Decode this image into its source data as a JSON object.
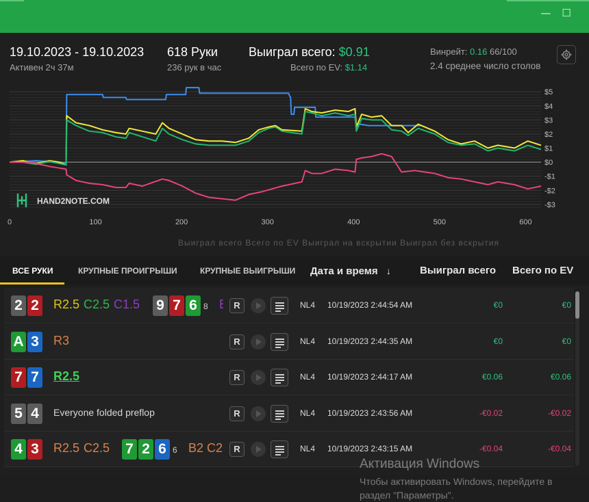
{
  "window": {
    "minimize_icon": "minimize-icon",
    "maximize_icon": "maximize-icon",
    "minimize_glyph": "—",
    "maximize_glyph": "☐"
  },
  "header": {
    "date_range": "19.10.2023 - 19.10.2023",
    "active_time": "Активен 2ч 37м",
    "hands": "618 Руки",
    "hands_per_hour": "236 рук в час",
    "won_total_label": "Выиграл всего:",
    "won_total_value": "$0.91",
    "ev_total_label": "Всего по EV:",
    "ev_total_value": "$1.14",
    "winrate_label": "Винрейт:",
    "winrate_value": "0.16",
    "winrate_hands": "66/100",
    "avg_tables": "2.4 среднее число столов"
  },
  "chart_data": {
    "type": "line",
    "x_ticks": [
      "0",
      "100",
      "200",
      "300",
      "400",
      "500",
      "600"
    ],
    "y_ticks": [
      "$5",
      "$4",
      "$3",
      "$2",
      "$1",
      "$0",
      "-$1",
      "-$2",
      "-$3"
    ],
    "xlim": [
      0,
      618
    ],
    "ylim": [
      -3.3,
      5.4
    ],
    "watermark": "HAND2NOTE.COM",
    "faded_legend": "Выиграл всего  Всего по EV  Выиграл на вскрытии  Выиграл без вскрытия",
    "series": [
      {
        "color": "#3d8ef0",
        "points": [
          [
            0,
            0
          ],
          [
            40,
            0.1
          ],
          [
            75,
            0
          ],
          [
            85,
            -0.05
          ],
          [
            86,
            4.8
          ],
          [
            140,
            4.8
          ],
          [
            141,
            4.6
          ],
          [
            175,
            4.6
          ],
          [
            176,
            4.45
          ],
          [
            235,
            4.45
          ],
          [
            236,
            4.8
          ],
          [
            265,
            4.8
          ],
          [
            266,
            5.3
          ],
          [
            285,
            5.3
          ],
          [
            286,
            4.9
          ],
          [
            420,
            4.9
          ],
          [
            421,
            4.75
          ],
          [
            423,
            4.6
          ],
          [
            424,
            3.4
          ],
          [
            428,
            3.4
          ],
          [
            429,
            3.9
          ],
          [
            460,
            3.9
          ],
          [
            461,
            3.2
          ],
          [
            520,
            3.2
          ],
          [
            521,
            2.75
          ],
          [
            540,
            2.6
          ],
          [
            620,
            2.6
          ]
        ]
      },
      {
        "color": "#f2ea3a",
        "points": [
          [
            0,
            0
          ],
          [
            20,
            0.1
          ],
          [
            40,
            -0.1
          ],
          [
            60,
            0.1
          ],
          [
            75,
            0
          ],
          [
            85,
            -0.2
          ],
          [
            86,
            3.3
          ],
          [
            100,
            2.8
          ],
          [
            120,
            2.6
          ],
          [
            140,
            2.3
          ],
          [
            160,
            2.1
          ],
          [
            175,
            2.0
          ],
          [
            180,
            2.4
          ],
          [
            200,
            2.2
          ],
          [
            220,
            2.0
          ],
          [
            230,
            2.8
          ],
          [
            240,
            2.4
          ],
          [
            260,
            2.0
          ],
          [
            280,
            1.6
          ],
          [
            300,
            1.5
          ],
          [
            320,
            1.5
          ],
          [
            340,
            1.4
          ],
          [
            360,
            1.7
          ],
          [
            375,
            2.3
          ],
          [
            390,
            2.5
          ],
          [
            400,
            2.6
          ],
          [
            410,
            2.3
          ],
          [
            440,
            2.2
          ],
          [
            445,
            3.8
          ],
          [
            455,
            3.6
          ],
          [
            470,
            3.5
          ],
          [
            490,
            3.7
          ],
          [
            510,
            3.6
          ],
          [
            520,
            3.8
          ],
          [
            522,
            2.5
          ],
          [
            530,
            3.4
          ],
          [
            545,
            3.2
          ],
          [
            560,
            3.3
          ],
          [
            575,
            2.6
          ],
          [
            590,
            2.6
          ],
          [
            600,
            2.1
          ],
          [
            615,
            2.7
          ],
          [
            640,
            2.2
          ],
          [
            660,
            1.6
          ],
          [
            680,
            1.3
          ],
          [
            700,
            1.5
          ],
          [
            720,
            1.0
          ],
          [
            735,
            1.2
          ],
          [
            760,
            1.0
          ],
          [
            780,
            1.5
          ],
          [
            800,
            1.2
          ]
        ]
      },
      {
        "color": "#22b86a",
        "points": [
          [
            0,
            0
          ],
          [
            20,
            0
          ],
          [
            40,
            -0.15
          ],
          [
            60,
            0.05
          ],
          [
            75,
            -0.1
          ],
          [
            85,
            -0.2
          ],
          [
            86,
            3.0
          ],
          [
            100,
            2.6
          ],
          [
            120,
            2.2
          ],
          [
            140,
            2.1
          ],
          [
            160,
            1.8
          ],
          [
            175,
            1.7
          ],
          [
            180,
            2.1
          ],
          [
            200,
            1.8
          ],
          [
            220,
            1.5
          ],
          [
            230,
            2.4
          ],
          [
            240,
            2.0
          ],
          [
            260,
            1.6
          ],
          [
            280,
            1.3
          ],
          [
            300,
            1.2
          ],
          [
            320,
            1.2
          ],
          [
            340,
            1.2
          ],
          [
            360,
            1.5
          ],
          [
            375,
            2.1
          ],
          [
            390,
            2.4
          ],
          [
            400,
            2.5
          ],
          [
            410,
            2.2
          ],
          [
            440,
            2.0
          ],
          [
            445,
            3.6
          ],
          [
            455,
            3.5
          ],
          [
            470,
            3.3
          ],
          [
            490,
            3.5
          ],
          [
            510,
            3.3
          ],
          [
            520,
            3.4
          ],
          [
            522,
            2.2
          ],
          [
            530,
            3.1
          ],
          [
            545,
            3.0
          ],
          [
            560,
            3.0
          ],
          [
            575,
            2.3
          ],
          [
            590,
            2.2
          ],
          [
            600,
            1.9
          ],
          [
            615,
            2.4
          ],
          [
            640,
            2.0
          ],
          [
            660,
            1.4
          ],
          [
            680,
            1.2
          ],
          [
            700,
            1.3
          ],
          [
            720,
            0.8
          ],
          [
            735,
            1.0
          ],
          [
            760,
            0.8
          ],
          [
            780,
            1.2
          ],
          [
            800,
            0.9
          ]
        ]
      },
      {
        "color": "#e8437a",
        "points": [
          [
            0,
            0
          ],
          [
            30,
            0
          ],
          [
            60,
            -0.3
          ],
          [
            85,
            -0.5
          ],
          [
            86,
            -0.9
          ],
          [
            100,
            -1.3
          ],
          [
            120,
            -1.5
          ],
          [
            140,
            -1.6
          ],
          [
            160,
            -1.8
          ],
          [
            175,
            -1.8
          ],
          [
            180,
            -1.5
          ],
          [
            200,
            -1.7
          ],
          [
            230,
            -1.2
          ],
          [
            240,
            -1.3
          ],
          [
            260,
            -1.7
          ],
          [
            280,
            -2.2
          ],
          [
            300,
            -2.5
          ],
          [
            320,
            -2.6
          ],
          [
            340,
            -2.7
          ],
          [
            360,
            -2.3
          ],
          [
            380,
            -2.1
          ],
          [
            395,
            -1.9
          ],
          [
            410,
            -1.7
          ],
          [
            440,
            -1.4
          ],
          [
            445,
            -0.6
          ],
          [
            455,
            -0.8
          ],
          [
            470,
            -0.8
          ],
          [
            490,
            -0.5
          ],
          [
            510,
            -0.6
          ],
          [
            520,
            -0.7
          ],
          [
            522,
            0.2
          ],
          [
            530,
            0.3
          ],
          [
            545,
            0.4
          ],
          [
            560,
            0.6
          ],
          [
            575,
            0.4
          ],
          [
            590,
            -0.7
          ],
          [
            610,
            -0.6
          ],
          [
            640,
            -0.8
          ],
          [
            660,
            -1.1
          ],
          [
            680,
            -1.2
          ],
          [
            700,
            -1.4
          ],
          [
            720,
            -1.6
          ],
          [
            735,
            -1.4
          ],
          [
            760,
            -1.6
          ],
          [
            780,
            -1.9
          ],
          [
            800,
            -1.7
          ]
        ]
      }
    ]
  },
  "tabs": {
    "all_hands": "ВСЕ РУКИ",
    "big_losses": "КРУПНЫЕ ПРОИГРЫШИ",
    "big_wins": "КРУПНЫЕ ВЫИГРЫШИ"
  },
  "columns": {
    "datetime": "Дата и время",
    "sort_arrow": "↓",
    "won_total": "Выиграл всего",
    "ev_total": "Всего по EV"
  },
  "rows": [
    {
      "hole": [
        {
          "r": "2",
          "c": "gray"
        },
        {
          "r": "2",
          "c": "red"
        }
      ],
      "actions": [
        {
          "t": "R2.5",
          "k": "y"
        },
        {
          "t": "C2.5",
          "k": "g"
        },
        {
          "t": "C1.5",
          "k": "p"
        }
      ],
      "board": [
        {
          "r": "9",
          "c": "gray"
        },
        {
          "r": "7",
          "c": "red"
        },
        {
          "r": "6",
          "c": "green"
        }
      ],
      "turn": "8",
      "river_frag": "E",
      "stake": "NL4",
      "datetime": "10/19/2023 2:44:54 AM",
      "won": "€0",
      "ev": "€0"
    },
    {
      "hole": [
        {
          "r": "A",
          "c": "green"
        },
        {
          "r": "3",
          "c": "blue"
        }
      ],
      "actions": [
        {
          "t": "R3",
          "k": "o"
        }
      ],
      "stake": "NL4",
      "datetime": "10/19/2023 2:44:35 AM",
      "won": "€0",
      "ev": "€0"
    },
    {
      "hole": [
        {
          "r": "7",
          "c": "red"
        },
        {
          "r": "7",
          "c": "blue"
        }
      ],
      "actions": [
        {
          "t": "R2.5",
          "k": "gu"
        }
      ],
      "stake": "NL4",
      "datetime": "10/19/2023 2:44:17 AM",
      "won": "€0.06",
      "ev": "€0.06"
    },
    {
      "hole": [
        {
          "r": "5",
          "c": "gray"
        },
        {
          "r": "4",
          "c": "gray"
        }
      ],
      "plain": "Everyone folded preflop",
      "stake": "NL4",
      "datetime": "10/19/2023 2:43:56 AM",
      "won": "-€0.02",
      "ev": "-€0.02"
    },
    {
      "hole": [
        {
          "r": "4",
          "c": "green"
        },
        {
          "r": "3",
          "c": "red"
        }
      ],
      "actions": [
        {
          "t": "R2.5",
          "k": "o"
        },
        {
          "t": "C2.5",
          "k": "o"
        }
      ],
      "board": [
        {
          "r": "7",
          "c": "green"
        },
        {
          "r": "2",
          "c": "green"
        },
        {
          "r": "6",
          "c": "blue"
        }
      ],
      "turn": "6",
      "post": "B2 C2",
      "stake": "NL4",
      "datetime": "10/19/2023 2:43:15 AM",
      "won": "-€0.04",
      "ev": "-€0.04"
    }
  ],
  "row_button": "R",
  "watermark": {
    "title": "Активация Windows",
    "text": "Чтобы активировать Windows, перейдите в раздел \"Параметры\"."
  }
}
